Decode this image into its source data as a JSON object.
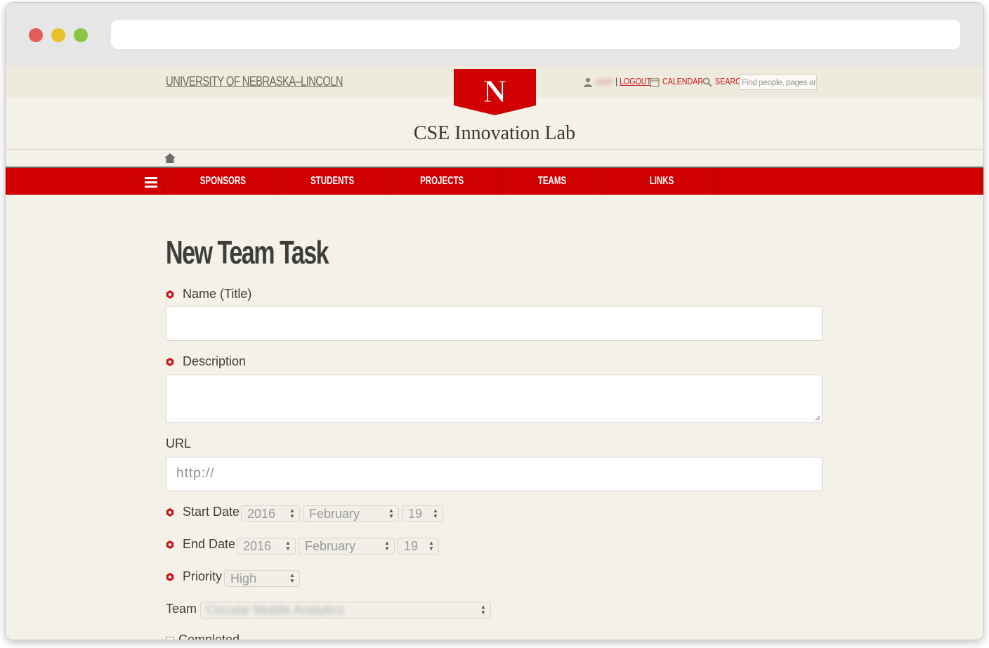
{
  "browser": {
    "url": ""
  },
  "header": {
    "university_link": "UNIVERSITY OF NEBRASKA–LINCOLN",
    "logo_letter": "N",
    "user_name": "user",
    "logout_label": "LOGOUT",
    "calendar_label": "CALENDAR",
    "search_label": "SEARCH",
    "search_placeholder": "Find people, pages and thi",
    "site_title": "CSE Innovation Lab"
  },
  "nav": {
    "items": [
      {
        "label": "SPONSORS"
      },
      {
        "label": "STUDENTS"
      },
      {
        "label": "PROJECTS"
      },
      {
        "label": "TEAMS"
      },
      {
        "label": "LINKS"
      }
    ],
    "brand_color": "#d00000"
  },
  "form": {
    "heading": "New Team Task",
    "name_label": "Name (Title)",
    "name_value": "",
    "description_label": "Description",
    "description_value": "",
    "url_label": "URL",
    "url_placeholder": "http://",
    "start_date_label": "Start Date",
    "start_year": "2016",
    "start_month": "February",
    "start_day": "19",
    "end_date_label": "End Date",
    "end_year": "2016",
    "end_month": "February",
    "end_day": "19",
    "priority_label": "Priority",
    "priority_value": "High",
    "team_label": "Team",
    "team_value": "Circular Mobile Analytics",
    "completed_label": "Completed"
  },
  "colors": {
    "required_marker": "#c7151a",
    "page_background": "#f4f1e8"
  }
}
